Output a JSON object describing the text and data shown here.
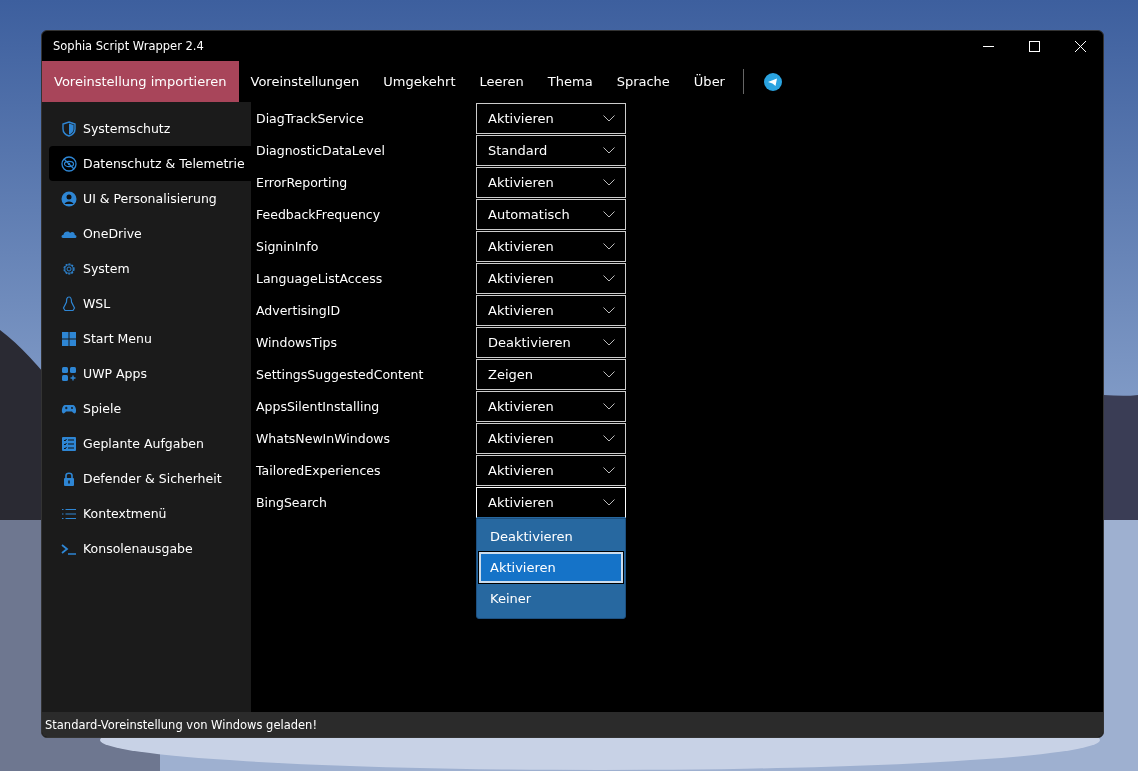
{
  "window": {
    "title": "Sophia Script Wrapper 2.4"
  },
  "menu": [
    {
      "label": "Voreinstellung importieren",
      "selected": true
    },
    {
      "label": "Voreinstellungen",
      "selected": false
    },
    {
      "label": "Umgekehrt",
      "selected": false
    },
    {
      "label": "Leeren",
      "selected": false
    },
    {
      "label": "Thema",
      "selected": false
    },
    {
      "label": "Sprache",
      "selected": false
    },
    {
      "label": "Über",
      "selected": false
    }
  ],
  "sidebar": {
    "items": [
      {
        "label": "Systemschutz",
        "kind": "shield",
        "selected": false
      },
      {
        "label": "Datenschutz & Telemetrie",
        "kind": "eye",
        "selected": true
      },
      {
        "label": "UI & Personalisierung",
        "kind": "user",
        "selected": false
      },
      {
        "label": "OneDrive",
        "kind": "cloud",
        "selected": false
      },
      {
        "label": "System",
        "kind": "gear",
        "selected": false
      },
      {
        "label": "WSL",
        "kind": "penguin",
        "selected": false
      },
      {
        "label": "Start Menu",
        "kind": "windows",
        "selected": false
      },
      {
        "label": "UWP Apps",
        "kind": "apps",
        "selected": false
      },
      {
        "label": "Spiele",
        "kind": "gamepad",
        "selected": false
      },
      {
        "label": "Geplante Aufgaben",
        "kind": "checklist",
        "selected": false
      },
      {
        "label": "Defender & Sicherheit",
        "kind": "lock",
        "selected": false
      },
      {
        "label": "Kontextmenü",
        "kind": "list",
        "selected": false
      },
      {
        "label": "Konsolenausgabe",
        "kind": "terminal",
        "selected": false
      }
    ]
  },
  "settings": [
    {
      "name": "DiagTrackService",
      "value": "Aktivieren"
    },
    {
      "name": "DiagnosticDataLevel",
      "value": "Standard"
    },
    {
      "name": "ErrorReporting",
      "value": "Aktivieren"
    },
    {
      "name": "FeedbackFrequency",
      "value": "Automatisch"
    },
    {
      "name": "SigninInfo",
      "value": "Aktivieren"
    },
    {
      "name": "LanguageListAccess",
      "value": "Aktivieren"
    },
    {
      "name": "AdvertisingID",
      "value": "Aktivieren"
    },
    {
      "name": "WindowsTips",
      "value": "Deaktivieren"
    },
    {
      "name": "SettingsSuggestedContent",
      "value": "Zeigen"
    },
    {
      "name": "AppsSilentInstalling",
      "value": "Aktivieren"
    },
    {
      "name": "WhatsNewInWindows",
      "value": "Aktivieren"
    },
    {
      "name": "TailoredExperiences",
      "value": "Aktivieren"
    },
    {
      "name": "BingSearch",
      "value": "Aktivieren",
      "expanded": true,
      "options": [
        {
          "label": "Deaktivieren",
          "selected": false
        },
        {
          "label": "Aktivieren",
          "selected": true
        },
        {
          "label": "Keiner",
          "selected": false
        }
      ]
    }
  ],
  "status_bar": "Standard-Voreinstellung von Windows geladen!"
}
